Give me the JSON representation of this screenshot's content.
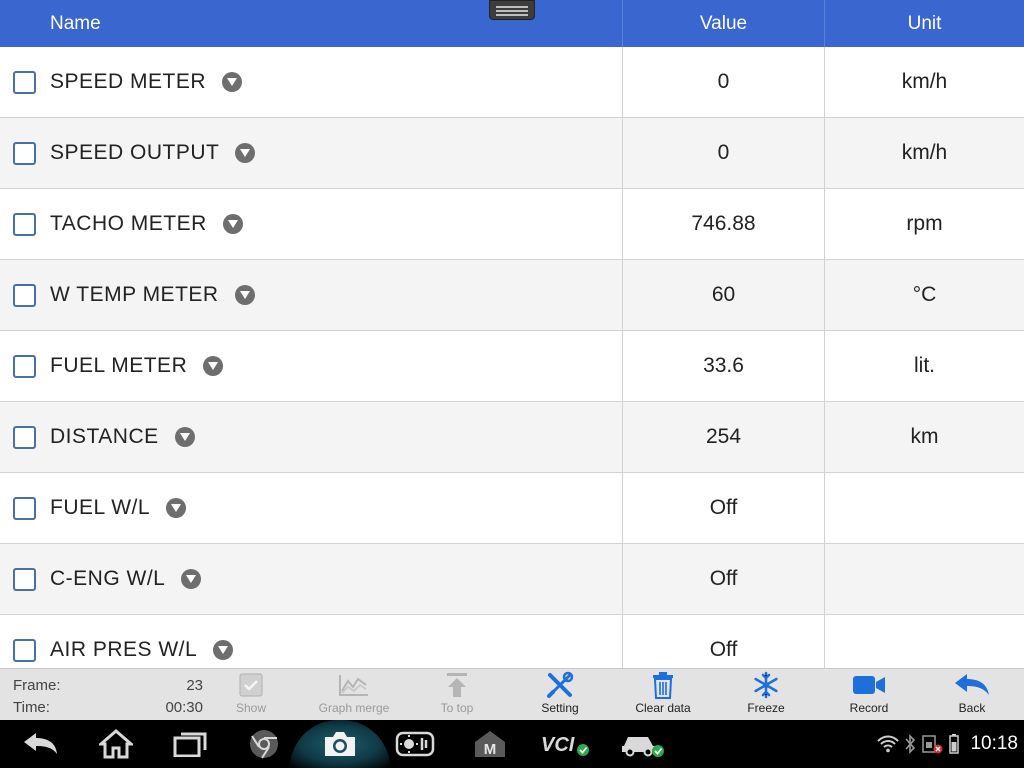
{
  "header": {
    "name_label": "Name",
    "value_label": "Value",
    "unit_label": "Unit"
  },
  "rows": [
    {
      "name": "SPEED METER",
      "value": "0",
      "unit": "km/h"
    },
    {
      "name": "SPEED OUTPUT",
      "value": "0",
      "unit": "km/h"
    },
    {
      "name": "TACHO METER",
      "value": "746.88",
      "unit": "rpm"
    },
    {
      "name": "W TEMP METER",
      "value": "60",
      "unit": "°C"
    },
    {
      "name": "FUEL METER",
      "value": "33.6",
      "unit": "lit."
    },
    {
      "name": "DISTANCE",
      "value": "254",
      "unit": "km"
    },
    {
      "name": "FUEL W/L",
      "value": "Off",
      "unit": ""
    },
    {
      "name": "C-ENG W/L",
      "value": "Off",
      "unit": ""
    },
    {
      "name": "AIR PRES W/L",
      "value": "Off",
      "unit": ""
    }
  ],
  "status": {
    "frame_label": "Frame:",
    "frame_value": "23",
    "time_label": "Time:",
    "time_value": "00:30"
  },
  "toolbar": {
    "show": "Show",
    "graph_merge": "Graph merge",
    "to_top": "To top",
    "setting": "Setting",
    "clear_data": "Clear data",
    "freeze": "Freeze",
    "record": "Record",
    "back": "Back"
  },
  "system": {
    "clock": "10:18",
    "vci_label": "VCI",
    "m_label": "M"
  },
  "colors": {
    "header_bg": "#3a66d0",
    "accent_blue": "#1e6fd9",
    "disabled_gray": "#9a9a9a"
  }
}
